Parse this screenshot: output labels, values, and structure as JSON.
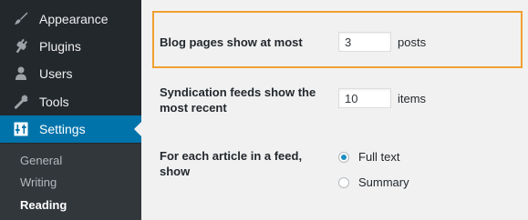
{
  "sidebar": {
    "items": [
      {
        "label": "Appearance",
        "icon": "paintbrush-icon"
      },
      {
        "label": "Plugins",
        "icon": "plug-icon"
      },
      {
        "label": "Users",
        "icon": "user-icon"
      },
      {
        "label": "Tools",
        "icon": "wrench-icon"
      },
      {
        "label": "Settings",
        "icon": "settings-icon",
        "active": true
      }
    ],
    "submenu": [
      {
        "label": "General"
      },
      {
        "label": "Writing"
      },
      {
        "label": "Reading",
        "current": true
      }
    ],
    "colors": {
      "background": "#23282d",
      "active": "#0073aa",
      "submenu_background": "#32373c"
    }
  },
  "settings": {
    "blog_pages": {
      "label": "Blog pages show at most",
      "value": "3",
      "unit": "posts",
      "highlighted": true,
      "highlight_color": "#f0a030"
    },
    "syndication": {
      "label_line1": "Syndication feeds show the",
      "label_line2": "most recent",
      "value": "10",
      "unit": "items"
    },
    "feed_article": {
      "label_line1": "For each article in a feed,",
      "label_line2": "show",
      "options": [
        {
          "label": "Full text",
          "checked": true
        },
        {
          "label": "Summary",
          "checked": false
        }
      ]
    }
  }
}
